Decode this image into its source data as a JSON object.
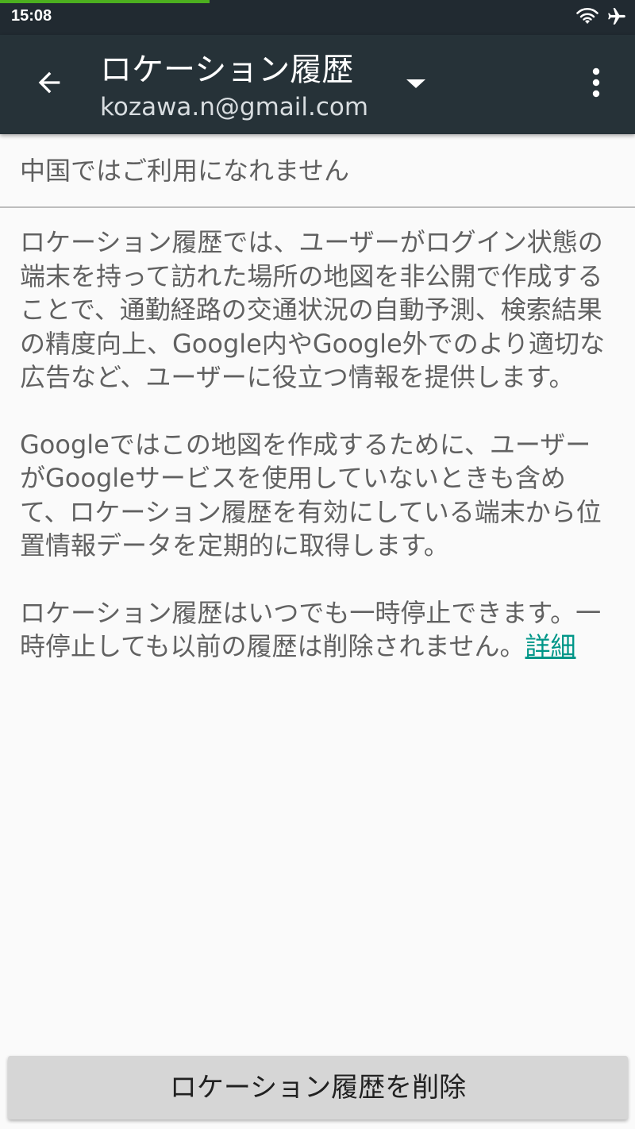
{
  "status_bar": {
    "time": "15:08",
    "icons": [
      "wifi-icon",
      "airplane-icon"
    ],
    "load_progress": 0.33
  },
  "app_bar": {
    "title": "ロケーション履歴",
    "account": "kozawa.n@gmail.com",
    "icons": {
      "back": "arrow-back-icon",
      "dropdown": "dropdown-triangle-icon",
      "overflow": "more-vert-icon"
    }
  },
  "content": {
    "unavailable_notice": "中国ではご利用になれません",
    "paragraph_1": "ロケーション履歴では、ユーザーがログイン状態の端末を持って訪れた場所の地図を非公開で作成することで、通勤経路の交通状況の自動予測、検索結果の精度向上、Google内やGoogle外でのより適切な広告など、ユーザーに役立つ情報を提供します。",
    "paragraph_2": "Googleではこの地図を作成するために、ユーザーがGoogleサービスを使用していないときも含めて、ロケーション履歴を有効にしている端末から位置情報データを定期的に取得します。",
    "paragraph_3": "ロケーション履歴はいつでも一時停止できます。一時停止しても以前の履歴は削除されません。",
    "learn_more_link": "詳細"
  },
  "actions": {
    "delete_button_label": "ロケーション履歴を削除"
  },
  "colors": {
    "status_bar": "#212a31",
    "app_bar": "#263238",
    "progress": "#4caf1f",
    "link": "#009688",
    "button": "#d6d6d6"
  }
}
